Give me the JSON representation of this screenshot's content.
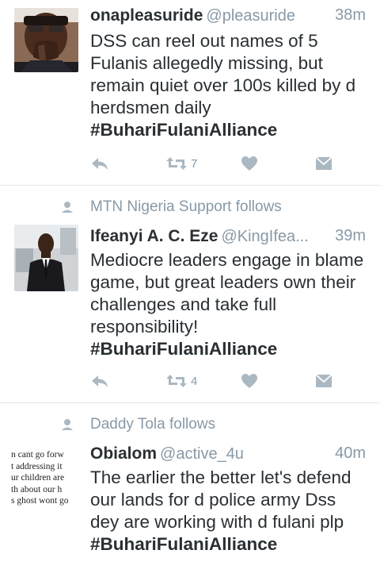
{
  "tweets": [
    {
      "social": "",
      "name": "onapleasuride",
      "handle": "@pleasuride",
      "time": "38m",
      "text": "DSS can reel out names of 5 Fulanis allegedly missing, but remain quiet over 100s killed by d herdsmen daily",
      "hashtag": "#BuhariFulaniAlliance",
      "retweets": "7",
      "avatar": "man-hand-on-chin-photo"
    },
    {
      "social": "MTN Nigeria Support follows",
      "name": "Ifeanyi A. C. Eze",
      "handle": "@KingIfea...",
      "time": "39m",
      "text": "Mediocre leaders engage in blame game, but great leaders own their challenges and take full responsibility!",
      "hashtag": "#BuhariFulaniAlliance",
      "retweets": "4",
      "avatar": "man-in-suit-photo"
    },
    {
      "social": "Daddy Tola follows",
      "name": "Obialom",
      "handle": "@active_4u",
      "time": "40m",
      "text": "The earlier the better let's defend our lands for d police army Dss dey are working with d fulani plp",
      "hashtag": "#BuhariFulaniAlliance",
      "avatar": "text-image",
      "avatar_text": [
        "n cant go forw",
        "t addressing it",
        "ur children are",
        "th about our h",
        "s ghost wont go"
      ]
    }
  ],
  "colors": {
    "text": "#292f33",
    "muted": "#8899a6",
    "icon": "#aab8c2",
    "divider": "#e1e8ed"
  }
}
